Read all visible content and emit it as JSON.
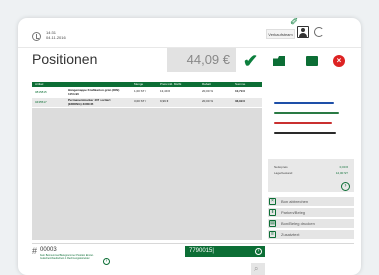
{
  "header": {
    "time": "14:31",
    "date": "04.11.2016",
    "user_button": "Verkaufsteam"
  },
  "main": {
    "title": "Positionen",
    "total": "44,09 €"
  },
  "table": {
    "columns": [
      "Artikel",
      "Menge",
      "Preis inkl. MwSt",
      "Rabatt",
      "Summe"
    ],
    "rows": [
      {
        "code": "0815815",
        "description": "Hängemappe Kraftkarton grün (DIN) 1154-90",
        "quantity": "1,00 ST /",
        "price": "13,49 €",
        "discount": "20,00 %",
        "sum": "10,79 €"
      },
      {
        "code": "0435517",
        "description": "Permanentmarker 407 sortiert (EDDING) 3300/45",
        "quantity": "3,00 ST /",
        "price": "9,99 €",
        "discount": "20,00 %",
        "sum": "33,99 €"
      }
    ]
  },
  "article_info": {
    "label_price": "Nettopreis",
    "price": "0,00 €",
    "label_stock": "Lagerbestand",
    "stock": "12,00 ST"
  },
  "actions": [
    {
      "icon": "x-icon",
      "label": "Bon abbrechen"
    },
    {
      "icon": "pause-icon",
      "label": "Parken/Beleg"
    },
    {
      "icon": "print-icon",
      "label": "Bon/Beleg drucken"
    },
    {
      "icon": "list-icon",
      "label": "Zusatztext"
    }
  ],
  "bottom": {
    "order_number": "00003",
    "order_description": "Kein Bonnummer/Belegnummer Position Einzel-Gutschein/Kaufschein 1 Rechnungskorrektur",
    "scan_value": "7790015|"
  },
  "pen_colors": [
    "#1e4fa8",
    "#2a7a44",
    "#c93030",
    "#2a2a2a"
  ],
  "colors": {
    "accent": "#0c6e35",
    "close": "#dd2222"
  }
}
